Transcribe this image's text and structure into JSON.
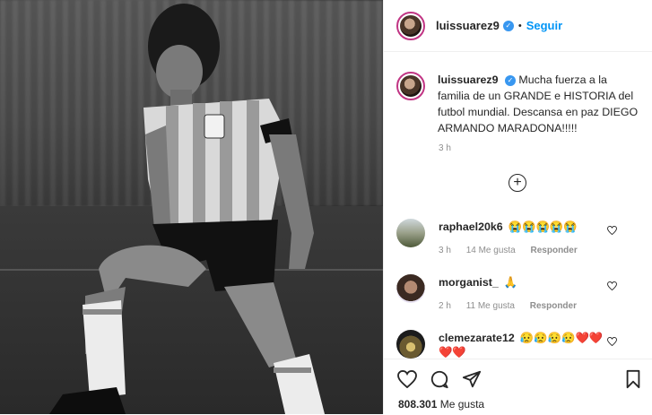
{
  "header": {
    "username": "luissuarez9",
    "verified_label": "✓",
    "separator": "•",
    "follow_label": "Seguir"
  },
  "caption": {
    "username": "luissuarez9",
    "verified_label": "✓",
    "text": "Mucha fuerza a la familia de un GRANDE e HISTORIA del futbol mundial. Descansa en paz DIEGO ARMANDO MARADONA!!!!!",
    "time": "3 h"
  },
  "load_more_label": "+",
  "comments": [
    {
      "username": "raphael20k6",
      "text": "😭😭😭😭😭",
      "time": "3 h",
      "likes": "14 Me gusta",
      "reply": "Responder"
    },
    {
      "username": "morganist_",
      "text": "🙏",
      "time": "2 h",
      "likes": "11 Me gusta",
      "reply": "Responder"
    },
    {
      "username": "clemezarate12",
      "text": "😥😥😥😥❤️❤️",
      "text_line2": "❤️❤️"
    }
  ],
  "actions": {
    "like_count": "808.301",
    "like_suffix": "Me gusta"
  },
  "colors": {
    "accent": "#0095f6",
    "verified": "#3897f0",
    "text": "#262626",
    "muted": "#8e8e8e",
    "border": "#efefef"
  }
}
